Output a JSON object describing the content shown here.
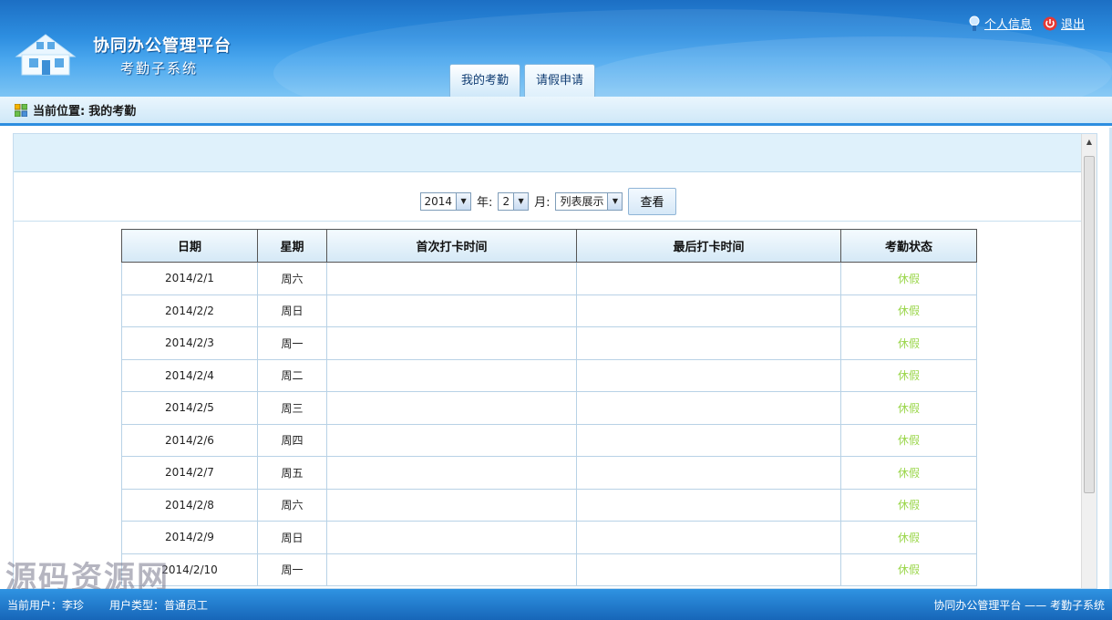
{
  "app": {
    "title": "协同办公管理平台",
    "subtitle": "考勤子系统"
  },
  "top_links": {
    "profile": "个人信息",
    "logout": "退出"
  },
  "tabs": [
    {
      "label": "我的考勤",
      "active": true
    },
    {
      "label": "请假申请",
      "active": false
    }
  ],
  "breadcrumb": {
    "label": "当前位置:",
    "value": "我的考勤"
  },
  "filter": {
    "year": "2014",
    "year_suffix": "年:",
    "month": "2",
    "month_suffix": "月:",
    "mode": "列表展示",
    "view_button": "查看"
  },
  "table": {
    "columns": [
      "日期",
      "星期",
      "首次打卡时间",
      "最后打卡时间",
      "考勤状态"
    ],
    "rows": [
      [
        "2014/2/1",
        "周六",
        "",
        "",
        "休假"
      ],
      [
        "2014/2/2",
        "周日",
        "",
        "",
        "休假"
      ],
      [
        "2014/2/3",
        "周一",
        "",
        "",
        "休假"
      ],
      [
        "2014/2/4",
        "周二",
        "",
        "",
        "休假"
      ],
      [
        "2014/2/5",
        "周三",
        "",
        "",
        "休假"
      ],
      [
        "2014/2/6",
        "周四",
        "",
        "",
        "休假"
      ],
      [
        "2014/2/7",
        "周五",
        "",
        "",
        "休假"
      ],
      [
        "2014/2/8",
        "周六",
        "",
        "",
        "休假"
      ],
      [
        "2014/2/9",
        "周日",
        "",
        "",
        "休假"
      ],
      [
        "2014/2/10",
        "周一",
        "",
        "",
        "休假"
      ]
    ]
  },
  "footer": {
    "user": "当前用户：李珍",
    "user_type": "用户类型：普通员工",
    "right": "协同办公管理平台 —— 考勤子系统"
  },
  "watermark": "源码资源网",
  "colors": {
    "header_blue": "#2d8ee0",
    "status_green": "#9ad64a"
  }
}
